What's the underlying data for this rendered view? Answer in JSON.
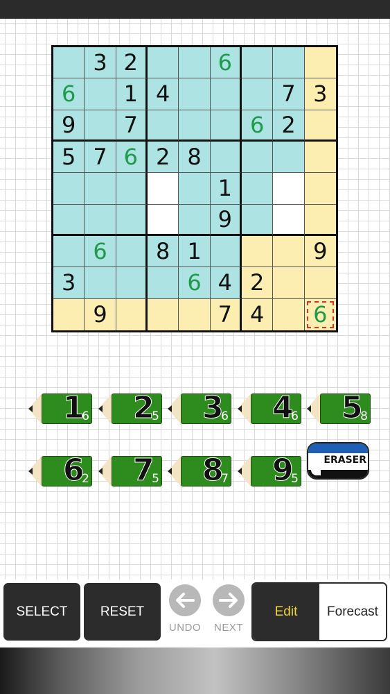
{
  "board": {
    "cells": [
      [
        {
          "v": "",
          "c": "blue",
          "t": ""
        },
        {
          "v": "3",
          "c": "blue",
          "t": "given"
        },
        {
          "v": "2",
          "c": "blue",
          "t": "given"
        },
        {
          "v": "",
          "c": "blue",
          "t": ""
        },
        {
          "v": "",
          "c": "blue",
          "t": ""
        },
        {
          "v": "6",
          "c": "blue",
          "t": "entered"
        },
        {
          "v": "",
          "c": "blue",
          "t": ""
        },
        {
          "v": "",
          "c": "blue",
          "t": ""
        },
        {
          "v": "",
          "c": "yellow",
          "t": ""
        }
      ],
      [
        {
          "v": "6",
          "c": "blue",
          "t": "entered"
        },
        {
          "v": "",
          "c": "blue",
          "t": ""
        },
        {
          "v": "1",
          "c": "blue",
          "t": "given"
        },
        {
          "v": "4",
          "c": "blue",
          "t": "given"
        },
        {
          "v": "",
          "c": "blue",
          "t": ""
        },
        {
          "v": "",
          "c": "blue",
          "t": ""
        },
        {
          "v": "",
          "c": "blue",
          "t": ""
        },
        {
          "v": "7",
          "c": "blue",
          "t": "given"
        },
        {
          "v": "3",
          "c": "yellow",
          "t": "given"
        }
      ],
      [
        {
          "v": "9",
          "c": "blue",
          "t": "given"
        },
        {
          "v": "",
          "c": "blue",
          "t": ""
        },
        {
          "v": "7",
          "c": "blue",
          "t": "given"
        },
        {
          "v": "",
          "c": "blue",
          "t": ""
        },
        {
          "v": "",
          "c": "blue",
          "t": ""
        },
        {
          "v": "",
          "c": "blue",
          "t": ""
        },
        {
          "v": "6",
          "c": "blue",
          "t": "entered"
        },
        {
          "v": "2",
          "c": "blue",
          "t": "given"
        },
        {
          "v": "",
          "c": "yellow",
          "t": ""
        }
      ],
      [
        {
          "v": "5",
          "c": "blue",
          "t": "given"
        },
        {
          "v": "7",
          "c": "blue",
          "t": "given"
        },
        {
          "v": "6",
          "c": "blue",
          "t": "entered"
        },
        {
          "v": "2",
          "c": "blue",
          "t": "given"
        },
        {
          "v": "8",
          "c": "blue",
          "t": "given"
        },
        {
          "v": "",
          "c": "blue",
          "t": ""
        },
        {
          "v": "",
          "c": "blue",
          "t": ""
        },
        {
          "v": "",
          "c": "blue",
          "t": ""
        },
        {
          "v": "",
          "c": "yellow",
          "t": ""
        }
      ],
      [
        {
          "v": "",
          "c": "blue",
          "t": ""
        },
        {
          "v": "",
          "c": "blue",
          "t": ""
        },
        {
          "v": "",
          "c": "blue",
          "t": ""
        },
        {
          "v": "",
          "c": "white",
          "t": ""
        },
        {
          "v": "",
          "c": "blue",
          "t": ""
        },
        {
          "v": "1",
          "c": "blue",
          "t": "given"
        },
        {
          "v": "",
          "c": "blue",
          "t": ""
        },
        {
          "v": "",
          "c": "white",
          "t": ""
        },
        {
          "v": "",
          "c": "yellow",
          "t": ""
        }
      ],
      [
        {
          "v": "",
          "c": "blue",
          "t": ""
        },
        {
          "v": "",
          "c": "blue",
          "t": ""
        },
        {
          "v": "",
          "c": "blue",
          "t": ""
        },
        {
          "v": "",
          "c": "white",
          "t": ""
        },
        {
          "v": "",
          "c": "blue",
          "t": ""
        },
        {
          "v": "9",
          "c": "blue",
          "t": "given"
        },
        {
          "v": "",
          "c": "blue",
          "t": ""
        },
        {
          "v": "",
          "c": "white",
          "t": ""
        },
        {
          "v": "",
          "c": "yellow",
          "t": ""
        }
      ],
      [
        {
          "v": "",
          "c": "blue",
          "t": ""
        },
        {
          "v": "6",
          "c": "blue",
          "t": "entered"
        },
        {
          "v": "",
          "c": "blue",
          "t": ""
        },
        {
          "v": "8",
          "c": "blue",
          "t": "given"
        },
        {
          "v": "1",
          "c": "blue",
          "t": "given"
        },
        {
          "v": "",
          "c": "blue",
          "t": ""
        },
        {
          "v": "",
          "c": "yellow",
          "t": ""
        },
        {
          "v": "",
          "c": "yellow",
          "t": ""
        },
        {
          "v": "9",
          "c": "yellow",
          "t": "given"
        }
      ],
      [
        {
          "v": "3",
          "c": "blue",
          "t": "given"
        },
        {
          "v": "",
          "c": "blue",
          "t": ""
        },
        {
          "v": "",
          "c": "blue",
          "t": ""
        },
        {
          "v": "",
          "c": "blue",
          "t": ""
        },
        {
          "v": "6",
          "c": "blue",
          "t": "entered"
        },
        {
          "v": "4",
          "c": "blue",
          "t": "given"
        },
        {
          "v": "2",
          "c": "yellow",
          "t": "given"
        },
        {
          "v": "",
          "c": "yellow",
          "t": ""
        },
        {
          "v": "",
          "c": "yellow",
          "t": ""
        }
      ],
      [
        {
          "v": "",
          "c": "yellow",
          "t": ""
        },
        {
          "v": "9",
          "c": "yellow",
          "t": "given"
        },
        {
          "v": "",
          "c": "yellow",
          "t": ""
        },
        {
          "v": "",
          "c": "yellow",
          "t": ""
        },
        {
          "v": "",
          "c": "yellow",
          "t": ""
        },
        {
          "v": "7",
          "c": "yellow",
          "t": "given"
        },
        {
          "v": "4",
          "c": "yellow",
          "t": "given"
        },
        {
          "v": "",
          "c": "yellow",
          "t": ""
        },
        {
          "v": "6",
          "c": "yellow",
          "t": "entered",
          "selected": true
        }
      ]
    ]
  },
  "pencils": [
    {
      "digit": "1",
      "count": "6"
    },
    {
      "digit": "2",
      "count": "5"
    },
    {
      "digit": "3",
      "count": "6"
    },
    {
      "digit": "4",
      "count": "6"
    },
    {
      "digit": "5",
      "count": "8"
    },
    {
      "digit": "6",
      "count": "2"
    },
    {
      "digit": "7",
      "count": "5"
    },
    {
      "digit": "8",
      "count": "7"
    },
    {
      "digit": "9",
      "count": "5"
    }
  ],
  "eraser": {
    "label": "ERASER"
  },
  "toolbar": {
    "select_label": "SELECT",
    "reset_label": "RESET",
    "undo_label": "UNDO",
    "next_label": "NEXT",
    "edit_label": "Edit",
    "forecast_label": "Forecast"
  },
  "colors": {
    "cell_blue": "#aee3e4",
    "cell_yellow": "#fbeeb0",
    "entered_digit": "#1f9a4a",
    "pencil_green": "#2e8b1d",
    "edit_active": "#f2d63a"
  }
}
